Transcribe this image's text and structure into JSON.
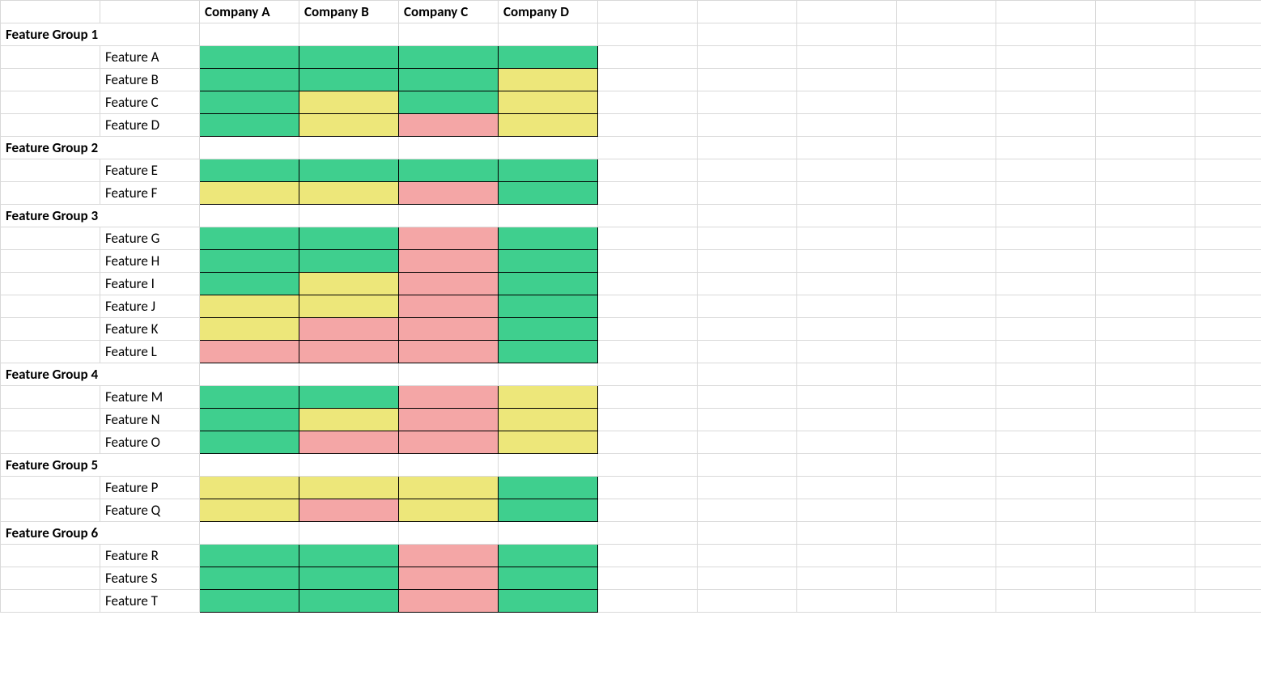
{
  "columns": [
    "Company A",
    "Company B",
    "Company C",
    "Company D"
  ],
  "extra_blank_columns": 7,
  "colors": {
    "green": "#3fcf8e",
    "yellow": "#ede77a",
    "red": "#f4a6a6"
  },
  "groups": [
    {
      "name": "Feature Group 1",
      "rows": [
        {
          "name": "Feature A",
          "cells": [
            "green",
            "green",
            "green",
            "green"
          ]
        },
        {
          "name": "Feature B",
          "cells": [
            "green",
            "green",
            "green",
            "yellow"
          ]
        },
        {
          "name": "Feature C",
          "cells": [
            "green",
            "yellow",
            "green",
            "yellow"
          ]
        },
        {
          "name": "Feature D",
          "cells": [
            "green",
            "yellow",
            "red",
            "yellow"
          ]
        }
      ]
    },
    {
      "name": "Feature Group 2",
      "rows": [
        {
          "name": "Feature E",
          "cells": [
            "green",
            "green",
            "green",
            "green"
          ]
        },
        {
          "name": "Feature F",
          "cells": [
            "yellow",
            "yellow",
            "red",
            "green"
          ]
        }
      ]
    },
    {
      "name": "Feature Group 3",
      "rows": [
        {
          "name": "Feature G",
          "cells": [
            "green",
            "green",
            "red",
            "green"
          ]
        },
        {
          "name": "Feature H",
          "cells": [
            "green",
            "green",
            "red",
            "green"
          ]
        },
        {
          "name": "Feature I",
          "cells": [
            "green",
            "yellow",
            "red",
            "green"
          ]
        },
        {
          "name": "Feature J",
          "cells": [
            "yellow",
            "yellow",
            "red",
            "green"
          ]
        },
        {
          "name": "Feature K",
          "cells": [
            "yellow",
            "red",
            "red",
            "green"
          ]
        },
        {
          "name": "Feature L",
          "cells": [
            "red",
            "red",
            "red",
            "green"
          ]
        }
      ]
    },
    {
      "name": "Feature Group 4",
      "rows": [
        {
          "name": "Feature M",
          "cells": [
            "green",
            "green",
            "red",
            "yellow"
          ]
        },
        {
          "name": "Feature N",
          "cells": [
            "green",
            "yellow",
            "red",
            "yellow"
          ]
        },
        {
          "name": "Feature O",
          "cells": [
            "green",
            "red",
            "red",
            "yellow"
          ]
        }
      ]
    },
    {
      "name": "Feature Group 5",
      "rows": [
        {
          "name": "Feature P",
          "cells": [
            "yellow",
            "yellow",
            "yellow",
            "green"
          ]
        },
        {
          "name": "Feature Q",
          "cells": [
            "yellow",
            "red",
            "yellow",
            "green"
          ]
        }
      ]
    },
    {
      "name": "Feature Group 6",
      "rows": [
        {
          "name": "Feature R",
          "cells": [
            "green",
            "green",
            "red",
            "green"
          ]
        },
        {
          "name": "Feature S",
          "cells": [
            "green",
            "green",
            "red",
            "green"
          ]
        },
        {
          "name": "Feature T",
          "cells": [
            "green",
            "green",
            "red",
            "green"
          ]
        }
      ]
    }
  ]
}
